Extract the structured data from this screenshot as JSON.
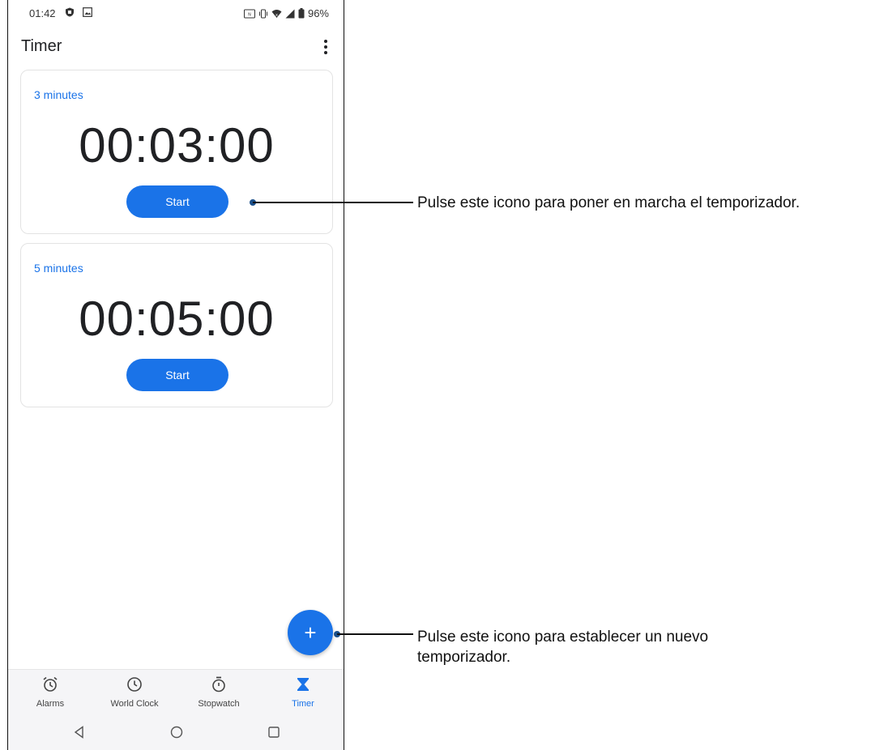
{
  "status_bar": {
    "time": "01:42",
    "battery": "96%",
    "left_icons": [
      "shield-icon",
      "image-icon"
    ],
    "right_icons": [
      "nfc-icon",
      "vibrate-icon",
      "wifi-icon",
      "signal-icon",
      "battery-icon"
    ]
  },
  "app_bar": {
    "title": "Timer",
    "overflow_icon": "more-vert-icon"
  },
  "timers": [
    {
      "label": "3 minutes",
      "time": "00:03:00",
      "start_label": "Start"
    },
    {
      "label": "5 minutes",
      "time": "00:05:00",
      "start_label": "Start"
    }
  ],
  "fab": {
    "label": "+"
  },
  "bottom_nav": {
    "items": [
      {
        "label": "Alarms",
        "icon": "alarm-icon",
        "active": false
      },
      {
        "label": "World Clock",
        "icon": "clock-icon",
        "active": false
      },
      {
        "label": "Stopwatch",
        "icon": "stopwatch-icon",
        "active": false
      },
      {
        "label": "Timer",
        "icon": "hourglass-icon",
        "active": true
      }
    ]
  },
  "system_nav": [
    "back-icon",
    "home-icon",
    "recents-icon"
  ],
  "annotations": {
    "start": "Pulse este icono para poner en marcha el temporizador.",
    "new_timer_line1": "Pulse este icono para establecer un nuevo",
    "new_timer_line2": "temporizador."
  },
  "colors": {
    "accent": "#1a73e8",
    "text": "#202124",
    "nav_background": "#f5f5f7"
  }
}
